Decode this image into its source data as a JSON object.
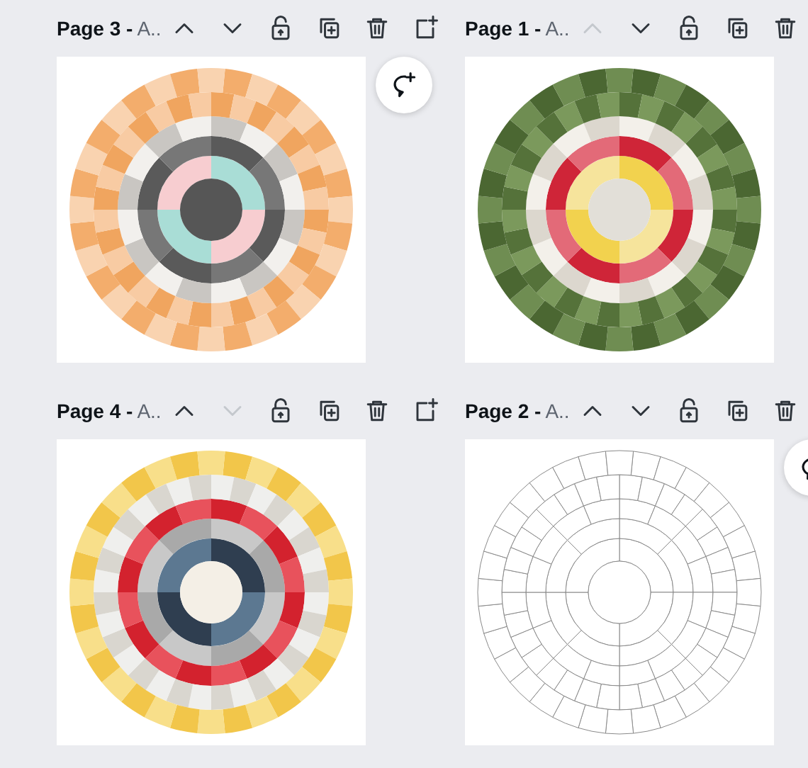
{
  "pages": [
    {
      "title": "Page 3 -",
      "name": "A..",
      "kind": "peach",
      "comment_button": true,
      "actions": [
        {
          "kind": "up",
          "disabled": false
        },
        {
          "kind": "down",
          "disabled": false
        },
        {
          "kind": "lock",
          "disabled": false
        },
        {
          "kind": "duplicate",
          "disabled": false
        },
        {
          "kind": "delete",
          "disabled": false
        },
        {
          "kind": "add",
          "disabled": false
        }
      ]
    },
    {
      "title": "Page 1 -",
      "name": "A..",
      "kind": "green",
      "comment_button": false,
      "actions": [
        {
          "kind": "up",
          "disabled": true
        },
        {
          "kind": "down",
          "disabled": false
        },
        {
          "kind": "lock",
          "disabled": false
        },
        {
          "kind": "duplicate",
          "disabled": false
        },
        {
          "kind": "delete",
          "disabled": false
        }
      ]
    },
    {
      "title": "Page 4 -",
      "name": "A..",
      "kind": "yellow",
      "comment_button": false,
      "actions": [
        {
          "kind": "up",
          "disabled": false
        },
        {
          "kind": "down",
          "disabled": true
        },
        {
          "kind": "lock",
          "disabled": false
        },
        {
          "kind": "duplicate",
          "disabled": false
        },
        {
          "kind": "delete",
          "disabled": false
        },
        {
          "kind": "add",
          "disabled": false
        }
      ]
    },
    {
      "title": "Page 2 -",
      "name": "A..",
      "kind": "outline",
      "comment_button": true,
      "actions": [
        {
          "kind": "up",
          "disabled": false
        },
        {
          "kind": "down",
          "disabled": false
        },
        {
          "kind": "lock",
          "disabled": false
        },
        {
          "kind": "duplicate",
          "disabled": false
        },
        {
          "kind": "delete",
          "disabled": false
        }
      ]
    }
  ]
}
